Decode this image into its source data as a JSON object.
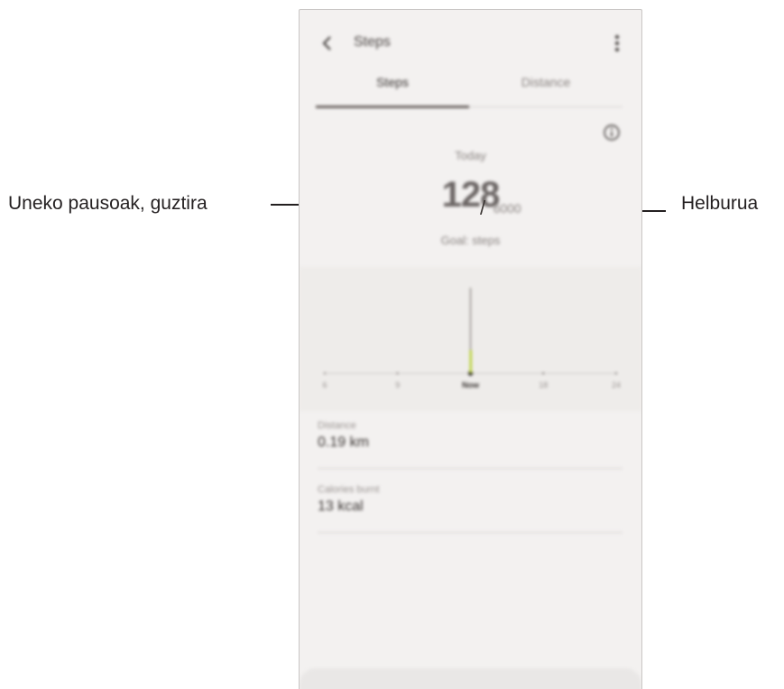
{
  "callouts": {
    "left": "Uneko pausoak, guztira",
    "right": "Helburua"
  },
  "app": {
    "title": "Steps",
    "menu_icon": "more-vertical-icon",
    "back_icon": "chevron-left-icon",
    "info_icon": "info-icon"
  },
  "tabs": [
    {
      "label": "Steps",
      "active": true
    },
    {
      "label": "Distance",
      "active": false
    }
  ],
  "summary": {
    "caption": "Today",
    "current": "128",
    "slash": "/",
    "goal": "6000",
    "subtitle": "Goal: steps"
  },
  "chart_data": {
    "type": "bar",
    "x_tick_labels": [
      "6",
      "9",
      "Now",
      "18",
      "24"
    ],
    "now_index": 2,
    "value_fraction": 0.85,
    "accent": "#b8d132"
  },
  "stats": [
    {
      "label": "Distance",
      "value": "0.19 km"
    },
    {
      "label": "Calories burnt",
      "value": "13 kcal"
    }
  ],
  "colors": {
    "accent": "#b8d132",
    "text": "#231f20",
    "background": "#f3f1f0"
  }
}
